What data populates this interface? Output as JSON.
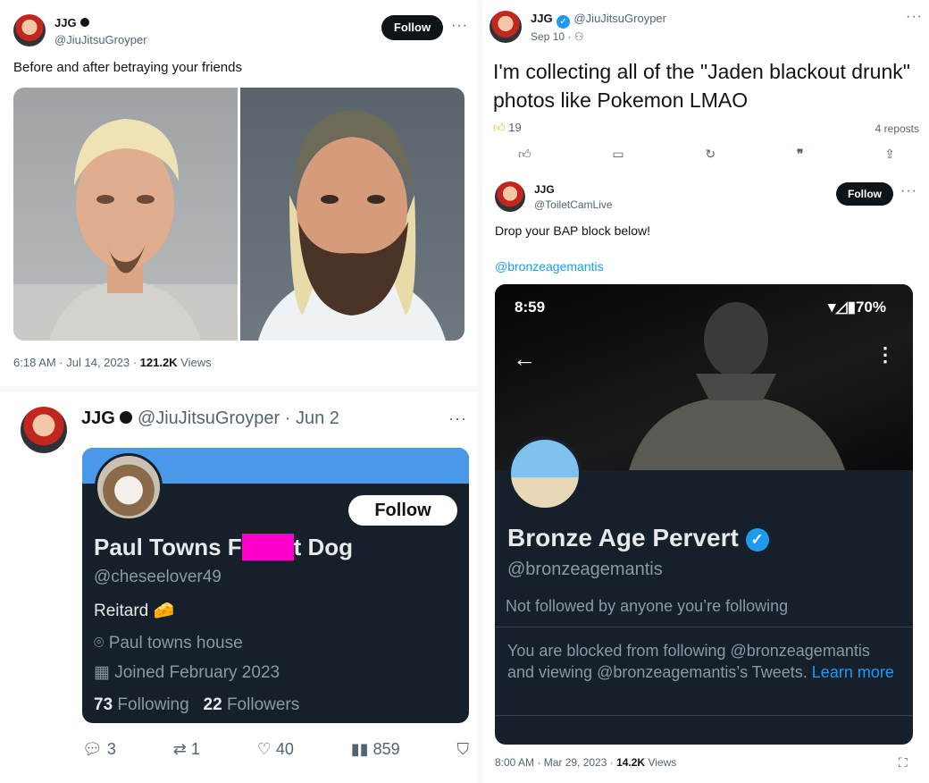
{
  "tweet1": {
    "name": "JJG",
    "handle": "@JiuJitsuGroyper",
    "follow": "Follow",
    "more": "···",
    "text": "Before and after betraying your friends",
    "timestamp": "6:18 AM · Jul 14, 2023 · ",
    "views": "121.2K",
    "views_label": " Views"
  },
  "tweet2": {
    "name": "JJG",
    "handle": "@JiuJitsuGroyper · Jun 2",
    "more": "···",
    "card": {
      "follow": "Follow",
      "display_name_a": "Paul Towns F",
      "display_name_b": "t Dog",
      "handle": "@cheseelover49",
      "bio": "Reitard 🧀",
      "location": "Paul towns house",
      "joined": "Joined February 2023",
      "following_count": "73",
      "following_label": "Following",
      "followers_count": "22",
      "followers_label": "Followers"
    },
    "replies": "3",
    "retweets": "1",
    "likes": "40",
    "views": "859"
  },
  "tweet3": {
    "name": "JJG",
    "handle": "@JiuJitsuGroyper",
    "date": "Sep 10 · ",
    "more": "···",
    "text": "I'm collecting all of the \"Jaden blackout drunk\" photos like Pokemon LMAO",
    "likes": "19",
    "reposts": "4 reposts"
  },
  "tweet4": {
    "name": "JJG",
    "handle": "@ToiletCamLive",
    "follow": "Follow",
    "more": "···",
    "text": "Drop your BAP block below!",
    "mention": "@bronzeagemantis",
    "phone": {
      "time": "8:59",
      "battery": "70%",
      "display_name": "Bronze Age Pervert",
      "handle": "@bronzeagemantis",
      "not_followed": "Not followed by anyone you’re following",
      "blocked_text": "You are blocked from following @bronzeagemantis and viewing @bronzeagemantis’s Tweets. ",
      "learn_more": "Learn more"
    },
    "timestamp": "8:00 AM · Mar 29, 2023 · ",
    "views": "14.2K",
    "views_label": " Views"
  },
  "colors": {
    "accent": "#1d9bf0",
    "dark_card": "#15202b",
    "redact": "#ff00cc"
  }
}
